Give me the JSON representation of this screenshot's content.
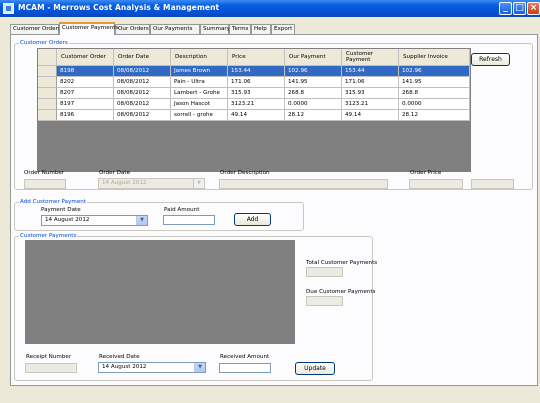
{
  "window": {
    "title": "MCAM - Merrows Cost Analysis & Management"
  },
  "tabs": [
    "Customer Orders",
    "Customer Payments",
    "Our Orders",
    "Our Payments",
    "Summary",
    "Terms",
    "Help",
    "Export"
  ],
  "customer_orders": {
    "title": "Customer Orders",
    "columns": [
      "Customer Order",
      "Order Date",
      "Description",
      "Price",
      "Our Payment",
      "Customer Payment",
      "Supplier Invoice"
    ],
    "rows": [
      [
        "8198",
        "08/08/2012",
        "James Brown",
        "153.44",
        "102.96",
        "153.44",
        "102.96"
      ],
      [
        "8202",
        "08/08/2012",
        "Pain - Ultra",
        "171.06",
        "141.95",
        "171.06",
        "141.95"
      ],
      [
        "8207",
        "08/08/2012",
        "Lambert - Grohe",
        "315.93",
        "268.8",
        "315.93",
        "268.8"
      ],
      [
        "8197",
        "08/08/2012",
        "Jason Hascot",
        "3123.21",
        "0.0000",
        "3123.21",
        "0.0000"
      ],
      [
        "8196",
        "08/08/2012",
        "sorrell - grohe",
        "49.14",
        "28.12",
        "49.14",
        "28.12"
      ]
    ],
    "refresh_label": "Refresh",
    "order_number_label": "Order Number",
    "order_date_label": "Order Date",
    "order_date_value": "14    August    2012",
    "order_description_label": "Order Description",
    "order_price_label": "Order Price"
  },
  "add_payment": {
    "title": "Add Customer Payment",
    "payment_date_label": "Payment Date",
    "payment_date_value": "14    August    2012",
    "paid_amount_label": "Paid Amount",
    "add_label": "Add"
  },
  "customer_payments": {
    "title": "Customer Payments",
    "total_label": "Total Customer Payments",
    "due_label": "Due Customer Payments",
    "receipt_number_label": "Receipt Number",
    "received_date_label": "Received Date",
    "received_date_value": "14   August   2012",
    "received_amount_label": "Received Amount",
    "update_label": "Update"
  }
}
